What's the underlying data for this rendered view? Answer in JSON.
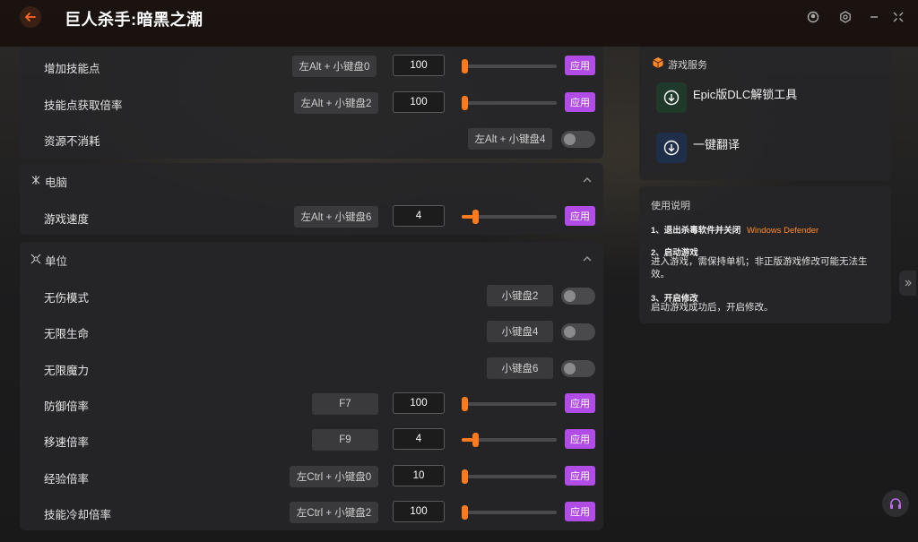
{
  "app": {
    "title": "巨人杀手:暗黑之潮",
    "accent": "#ff7a1a",
    "apply_color": "#b14ce6",
    "icons": [
      "back-arrow-icon",
      "user-icon",
      "settings-icon",
      "shrink-icon"
    ]
  },
  "panel1": {
    "rows": [
      {
        "label": "增加技能点",
        "hotkey": "左Alt + 小键盘0",
        "value": "100",
        "apply": "应用",
        "slider_fraction": 0.0
      },
      {
        "label": "技能点获取倍率",
        "hotkey": "左Alt + 小键盘2",
        "value": "100",
        "apply": "应用",
        "slider_fraction": 0.0
      },
      {
        "label": "资源不消耗",
        "hotkey": "左Alt + 小键盘4",
        "toggle": false
      }
    ]
  },
  "panel2": {
    "title": "电脑",
    "rows": [
      {
        "label": "游戏速度",
        "hotkey": "左Alt + 小键盘6",
        "value": "4",
        "apply": "应用",
        "slider_fraction": 0.12
      }
    ]
  },
  "panel3": {
    "title": "单位",
    "rows": [
      {
        "label": "无伤模式",
        "hotkey": "小键盘2",
        "toggle": false
      },
      {
        "label": "无限生命",
        "hotkey": "小键盘4",
        "toggle": false
      },
      {
        "label": "无限魔力",
        "hotkey": "小键盘6",
        "toggle": false
      },
      {
        "label": "防御倍率",
        "hotkey": "F7",
        "value": "100",
        "apply": "应用",
        "slider_fraction": 0.0
      },
      {
        "label": "移速倍率",
        "hotkey": "F9",
        "value": "4",
        "apply": "应用",
        "slider_fraction": 0.12
      },
      {
        "label": "经验倍率",
        "hotkey": "左Ctrl + 小键盘0",
        "value": "10",
        "apply": "应用",
        "slider_fraction": 0.0
      },
      {
        "label": "技能冷却倍率",
        "hotkey": "左Ctrl + 小键盘2",
        "value": "100",
        "apply": "应用",
        "slider_fraction": 0.0
      }
    ]
  },
  "services": {
    "title": "游戏服务",
    "items": [
      {
        "name": "Epic版DLC解锁工具",
        "icon": "download-icon",
        "color": "#1f3a2a"
      },
      {
        "name": "一键翻译",
        "icon": "download-icon",
        "color": "#1f2f4a"
      }
    ]
  },
  "guide": {
    "title": "使用说明",
    "step1_head": "1、退出杀毒软件并关闭",
    "step1_link": "Windows Defender",
    "step2_head": "2、启动游戏",
    "step2_text": "进入游戏，需保持单机；非正版游戏修改可能无法生效。",
    "step3_head": "3、开启修改",
    "step3_text": "启动游戏成功后，开启修改。"
  }
}
